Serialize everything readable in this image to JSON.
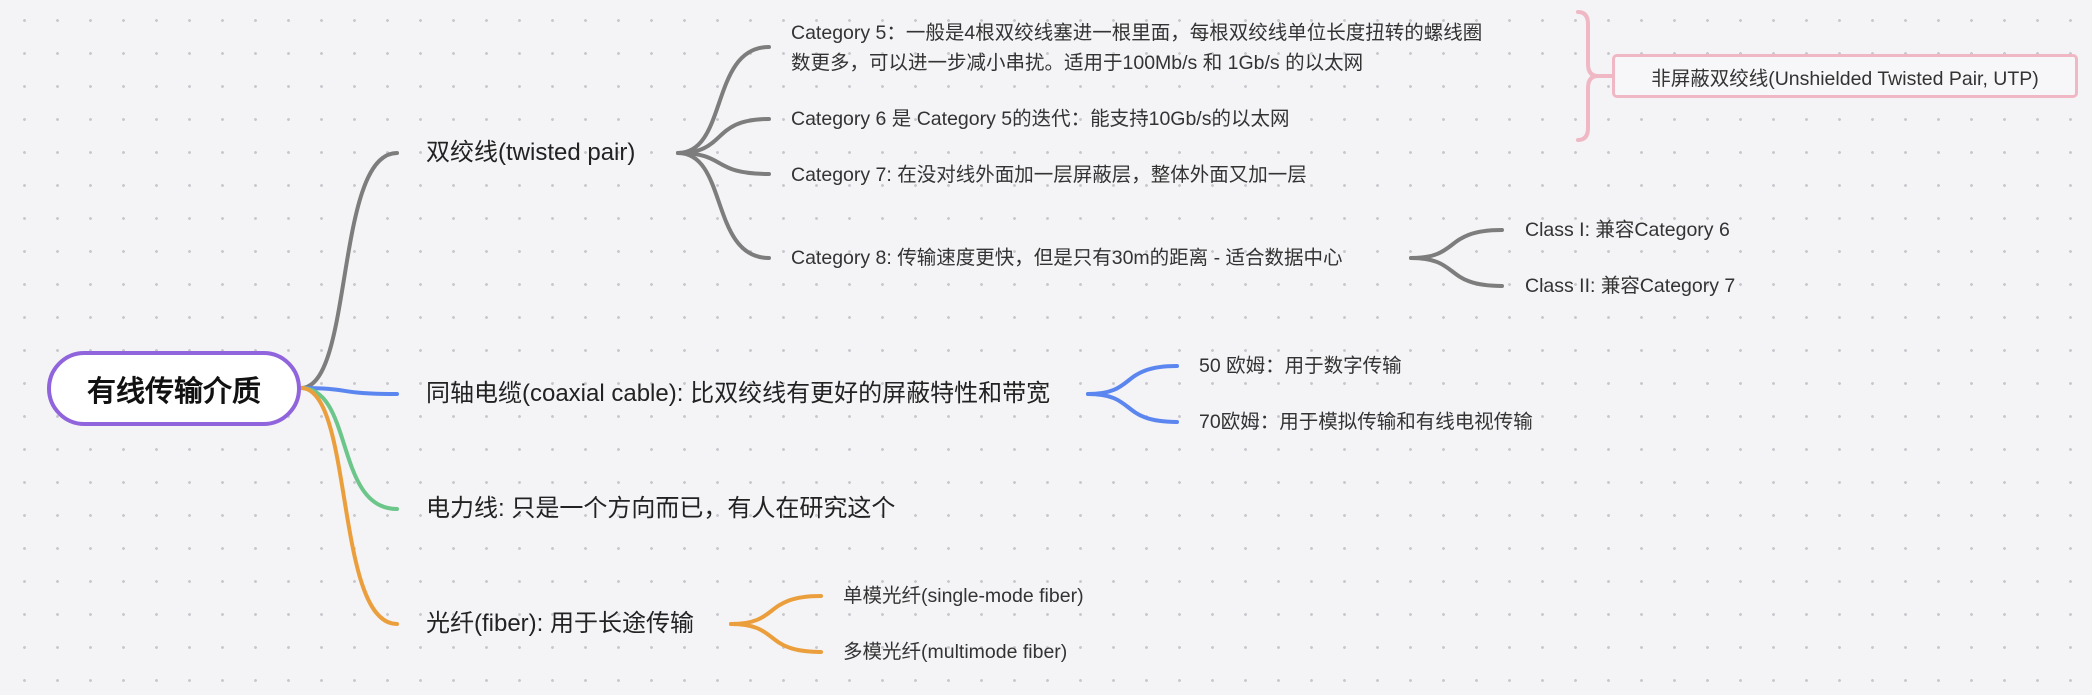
{
  "root": {
    "label": "有线传输介质",
    "color": "#9064dc"
  },
  "branches": [
    {
      "key": "twisted",
      "label": "双绞线(twisted pair)",
      "color": "#7d7d7d",
      "children": [
        {
          "key": "cat5",
          "lines": [
            "Category 5：一般是4根双绞线塞进一根里面，每根双绞线单位长度扭转的螺线圈",
            "数更多，可以进一步减小串扰。适用于100Mb/s 和 1Gb/s 的以太网"
          ]
        },
        {
          "key": "cat6",
          "lines": [
            "Category 6 是 Category 5的迭代：能支持10Gb/s的以太网"
          ]
        },
        {
          "key": "cat7",
          "lines": [
            "Category 7: 在没对线外面加一层屏蔽层，整体外面又加一层"
          ]
        },
        {
          "key": "cat8",
          "lines": [
            "Category 8: 传输速度更快，但是只有30m的距离 - 适合数据中心"
          ],
          "children": [
            {
              "key": "class1",
              "label": "Class I: 兼容Category 6"
            },
            {
              "key": "class2",
              "label": "Class II: 兼容Category 7"
            }
          ]
        }
      ]
    },
    {
      "key": "coaxial",
      "label": "同轴电缆(coaxial cable): 比双绞线有更好的屏蔽特性和带宽",
      "color": "#5b86f0",
      "children": [
        {
          "key": "ohm50",
          "label": "50 欧姆：用于数字传输"
        },
        {
          "key": "ohm70",
          "label": "70欧姆：用于模拟传输和有线电视传输"
        }
      ]
    },
    {
      "key": "power",
      "label": "电力线: 只是一个方向而已，有人在研究这个",
      "color": "#6cc68a",
      "children": []
    },
    {
      "key": "fiber",
      "label": "光纤(fiber): 用于长途传输",
      "color": "#eb9f3c",
      "children": [
        {
          "key": "single",
          "label": "单模光纤(single-mode fiber)"
        },
        {
          "key": "multi",
          "label": "多模光纤(multimode fiber)"
        }
      ]
    }
  ],
  "summary": {
    "label": "非屏蔽双绞线(Unshielded Twisted Pair, UTP)",
    "color": "#efb8c4"
  }
}
